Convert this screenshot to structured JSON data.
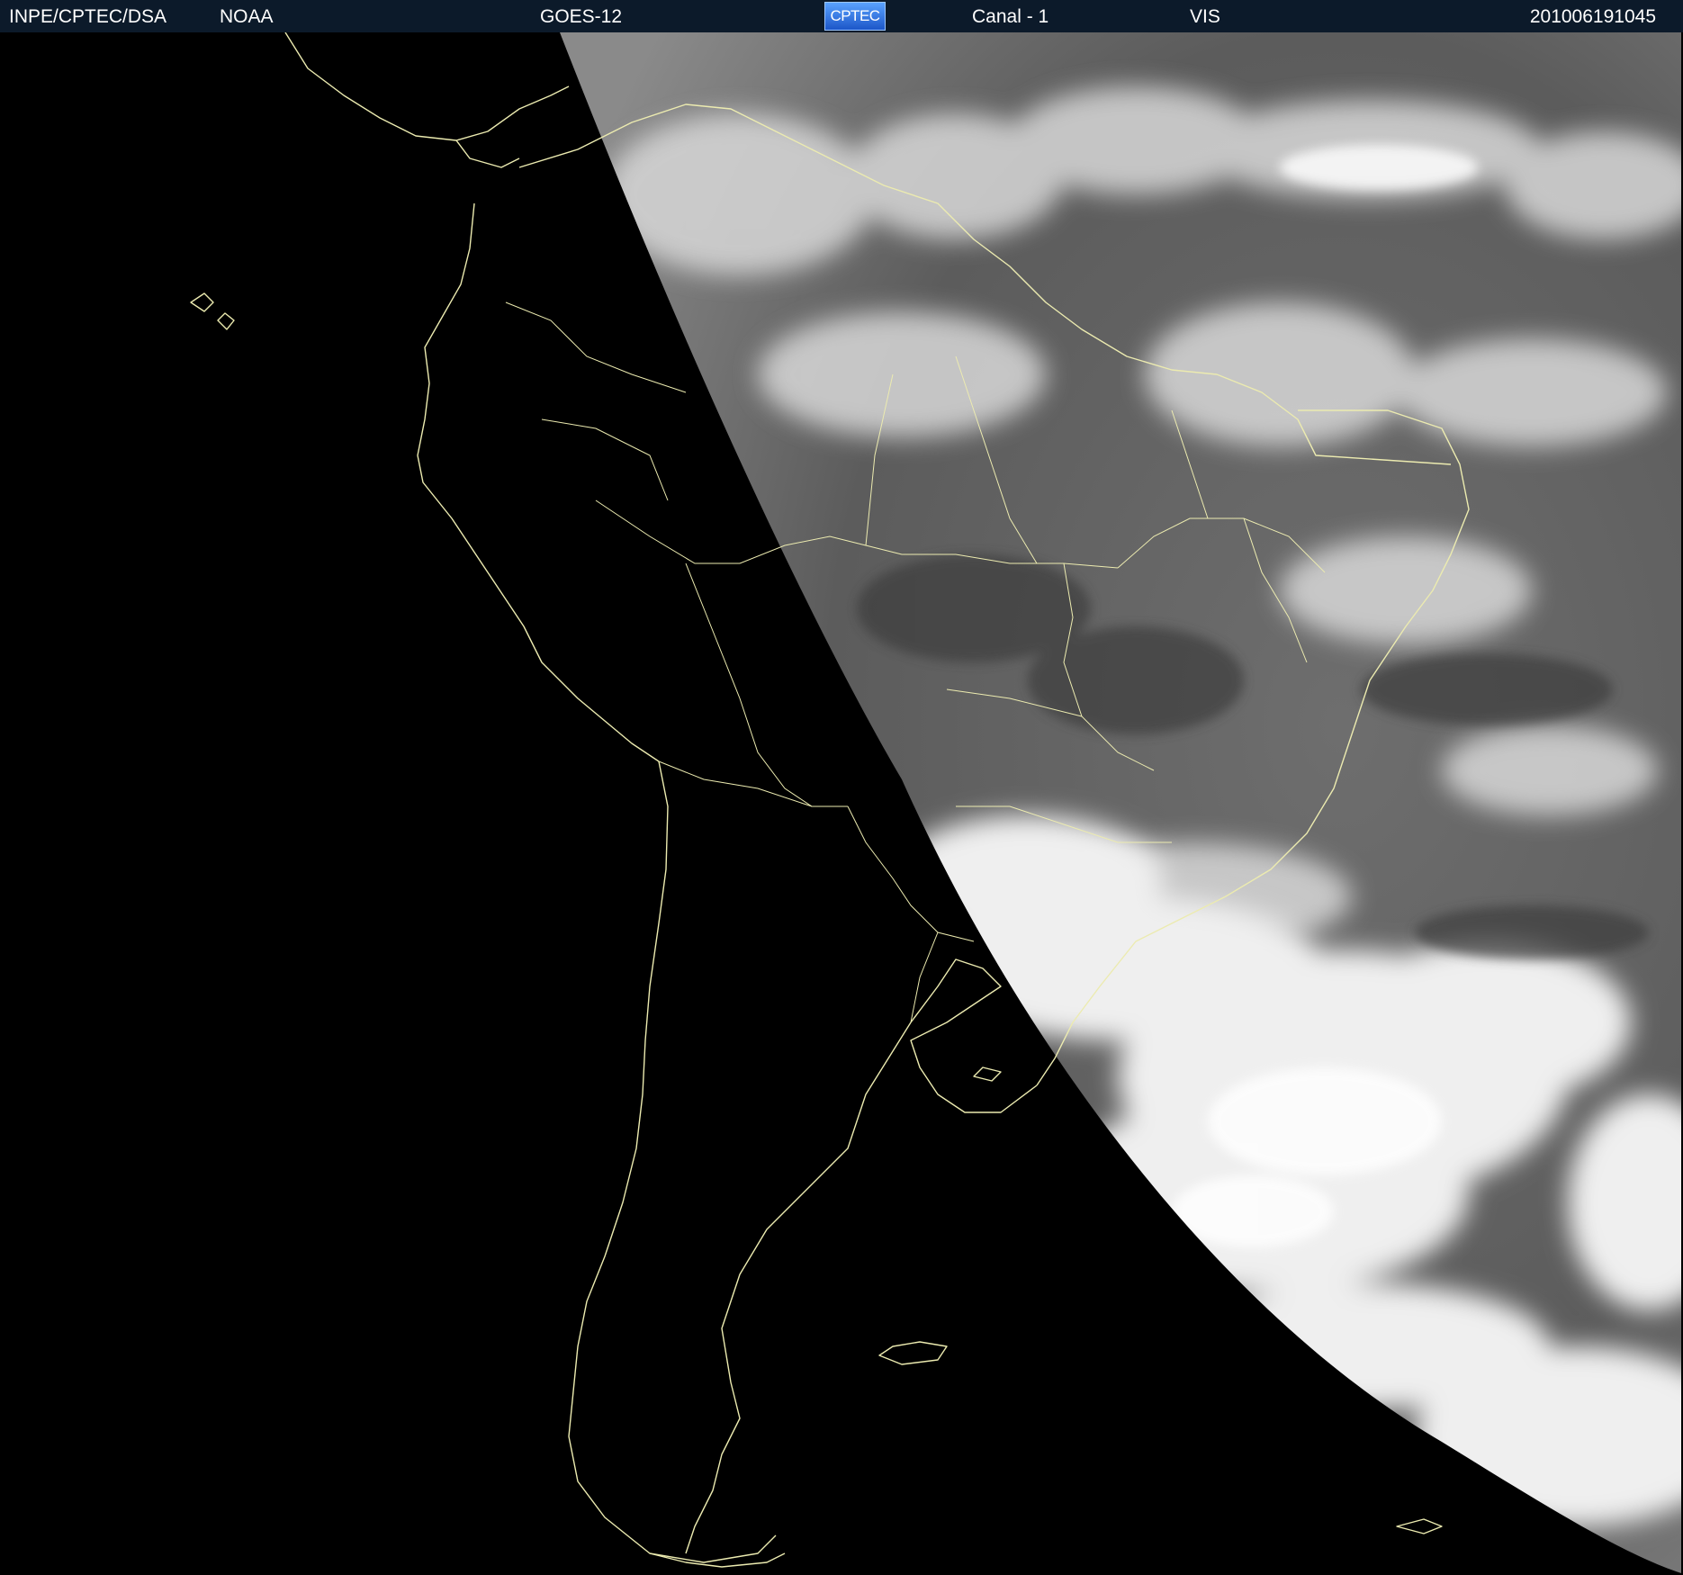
{
  "header": {
    "organization": "INPE/CPTEC/DSA",
    "agency": "NOAA",
    "satellite": "GOES-12",
    "logo_text": "CPTEC",
    "channel": "Canal - 1",
    "band": "VIS",
    "timestamp": "201006191045"
  },
  "colors": {
    "header_bg": "#0c1a2a",
    "header_text": "#ffffff",
    "map_outline": "#ecebb0",
    "night_side": "#000000",
    "day_side_base": "#5a5a5a",
    "cloud_white": "#f2f2f2"
  },
  "image": {
    "type": "visible satellite imagery, South America",
    "terminator": "night side on the west, lit side on the east"
  }
}
